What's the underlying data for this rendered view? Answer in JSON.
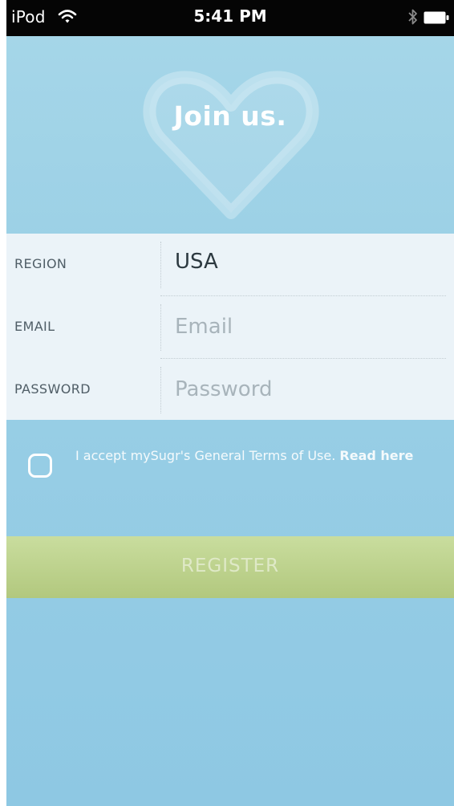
{
  "status_bar": {
    "device": "iPod",
    "time": "5:41 PM",
    "wifi_icon": "wifi-icon",
    "bluetooth_icon": "bluetooth-icon",
    "battery_icon": "battery-icon"
  },
  "hero": {
    "title": "Join us.",
    "icon": "heart-icon"
  },
  "form": {
    "region": {
      "label": "REGION",
      "value": "USA"
    },
    "email": {
      "label": "EMAIL",
      "placeholder": "Email"
    },
    "password": {
      "label": "PASSWORD",
      "placeholder": "Password"
    }
  },
  "terms": {
    "text": "I accept mySugr's General Terms of Use.",
    "link": "Read here",
    "checked": false
  },
  "register": {
    "label": "REGISTER"
  },
  "colors": {
    "background_top": "#a5d6e8",
    "background_bottom": "#8ec8e3",
    "form_background": "#ebf3f8",
    "register_button": "#c2d795",
    "status_bar": "#050505"
  }
}
